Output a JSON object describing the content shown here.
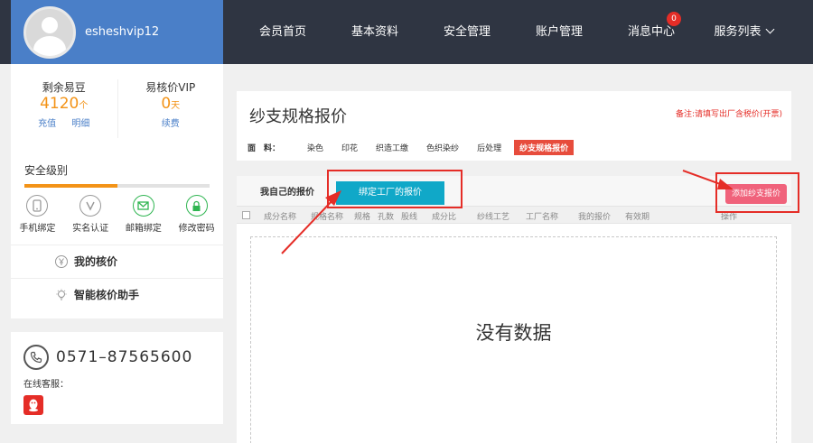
{
  "header": {
    "username": "esheshvip12",
    "nav": [
      {
        "label": "会员首页"
      },
      {
        "label": "基本资料"
      },
      {
        "label": "安全管理"
      },
      {
        "label": "账户管理"
      },
      {
        "label": "消息中心",
        "badge": "0"
      },
      {
        "label": "服务列表"
      }
    ]
  },
  "sidebar": {
    "beans": {
      "title": "剩余易豆",
      "value": "4120",
      "unit": "个",
      "link1": "充值",
      "link2": "明细"
    },
    "vip": {
      "title": "易核价VIP",
      "value": "0",
      "unit": "天",
      "link1": "续费"
    },
    "security": {
      "label": "安全级别",
      "level_fraction": 0.5,
      "items": [
        {
          "label": "手机绑定",
          "icon": "phone-icon",
          "color": "#999999"
        },
        {
          "label": "实名认证",
          "icon": "verified-icon",
          "color": "#999999"
        },
        {
          "label": "邮箱绑定",
          "icon": "mail-icon",
          "color": "#2fb551"
        },
        {
          "label": "修改密码",
          "icon": "lock-icon",
          "color": "#2fb551"
        }
      ]
    },
    "menu": [
      {
        "label": "我的核价",
        "icon": "yuan-icon"
      },
      {
        "label": "智能核价助手",
        "icon": "lightbulb-icon"
      }
    ],
    "contact": {
      "phone": "0571–87565600",
      "online_label": "在线客服："
    }
  },
  "main": {
    "title": "纱支规格报价",
    "note": "备注:请填写出厂含税价(开票)",
    "category_label": "面　料：",
    "categories": [
      {
        "label": "染色",
        "active": false
      },
      {
        "label": "印花",
        "active": false
      },
      {
        "label": "织造工缴",
        "active": false
      },
      {
        "label": "色织染纱",
        "active": false
      },
      {
        "label": "后处理",
        "active": false
      },
      {
        "label": "纱支规格报价",
        "active": true
      }
    ],
    "tabs": {
      "mine": "我自己的报价",
      "bound": "绑定工厂的报价"
    },
    "add_button": "添加纱支报价",
    "columns": [
      "成分名称",
      "规格名称",
      "规格",
      "孔数",
      "股线",
      "成分比",
      "纱线工艺",
      "工厂名称",
      "我的报价",
      "有效期",
      "操作"
    ],
    "empty_text": "没有数据"
  },
  "colors": {
    "accent_orange": "#f39317",
    "header_bg": "#2f3542",
    "user_blue": "#4a7fc8",
    "tab_cyan": "#10a8c8",
    "annotation_red": "#e52d27"
  }
}
